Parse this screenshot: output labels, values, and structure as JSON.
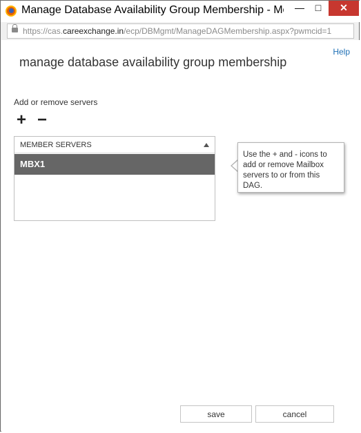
{
  "window": {
    "title": "Manage Database Availability Group Membership - Mozill...",
    "minimize_glyph": "—",
    "maximize_glyph": "□",
    "close_glyph": "✕"
  },
  "address": {
    "url_prefix": "https://cas.",
    "url_domain": "careexchange.in",
    "url_suffix": "/ecp/DBMgmt/ManageDAGMembership.aspx?pwmcid=1"
  },
  "page": {
    "help": "Help",
    "heading": "manage database availability group membership",
    "subheading": "Add or remove servers",
    "add_glyph": "+",
    "remove_glyph": "−"
  },
  "servers": {
    "column_header": "MEMBER SERVERS",
    "rows": [
      "MBX1"
    ]
  },
  "tooltip": {
    "text": "Use the + and - icons to add or remove Mailbox servers to or from this DAG."
  },
  "buttons": {
    "save": "save",
    "cancel": "cancel"
  },
  "colors": {
    "selected_row": "#666666",
    "close_button": "#c7372f",
    "link": "#1e6fb5"
  }
}
